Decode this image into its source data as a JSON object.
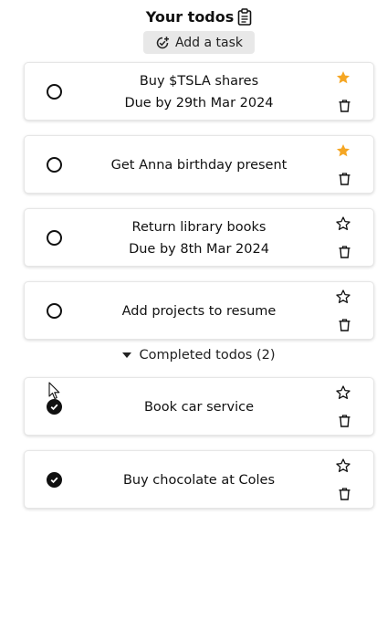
{
  "header": {
    "title": "Your todos"
  },
  "add_button": {
    "label": "Add a task"
  },
  "colors": {
    "star_active": "#f5a623",
    "text": "#111111",
    "add_bg": "#e8e8e8"
  },
  "todos": [
    {
      "title": "Buy $TSLA shares",
      "due": "Due by 29th Mar 2024",
      "starred": true,
      "done": false
    },
    {
      "title": "Get Anna birthday present",
      "due": "",
      "starred": true,
      "done": false
    },
    {
      "title": "Return library books",
      "due": "Due by 8th Mar 2024",
      "starred": false,
      "done": false
    },
    {
      "title": "Add projects to resume",
      "due": "",
      "starred": false,
      "done": false
    }
  ],
  "completed_section": {
    "label": "Completed todos (2)"
  },
  "completed": [
    {
      "title": "Book car service",
      "starred": false,
      "done": true
    },
    {
      "title": "Buy chocolate at Coles",
      "starred": false,
      "done": true
    }
  ]
}
